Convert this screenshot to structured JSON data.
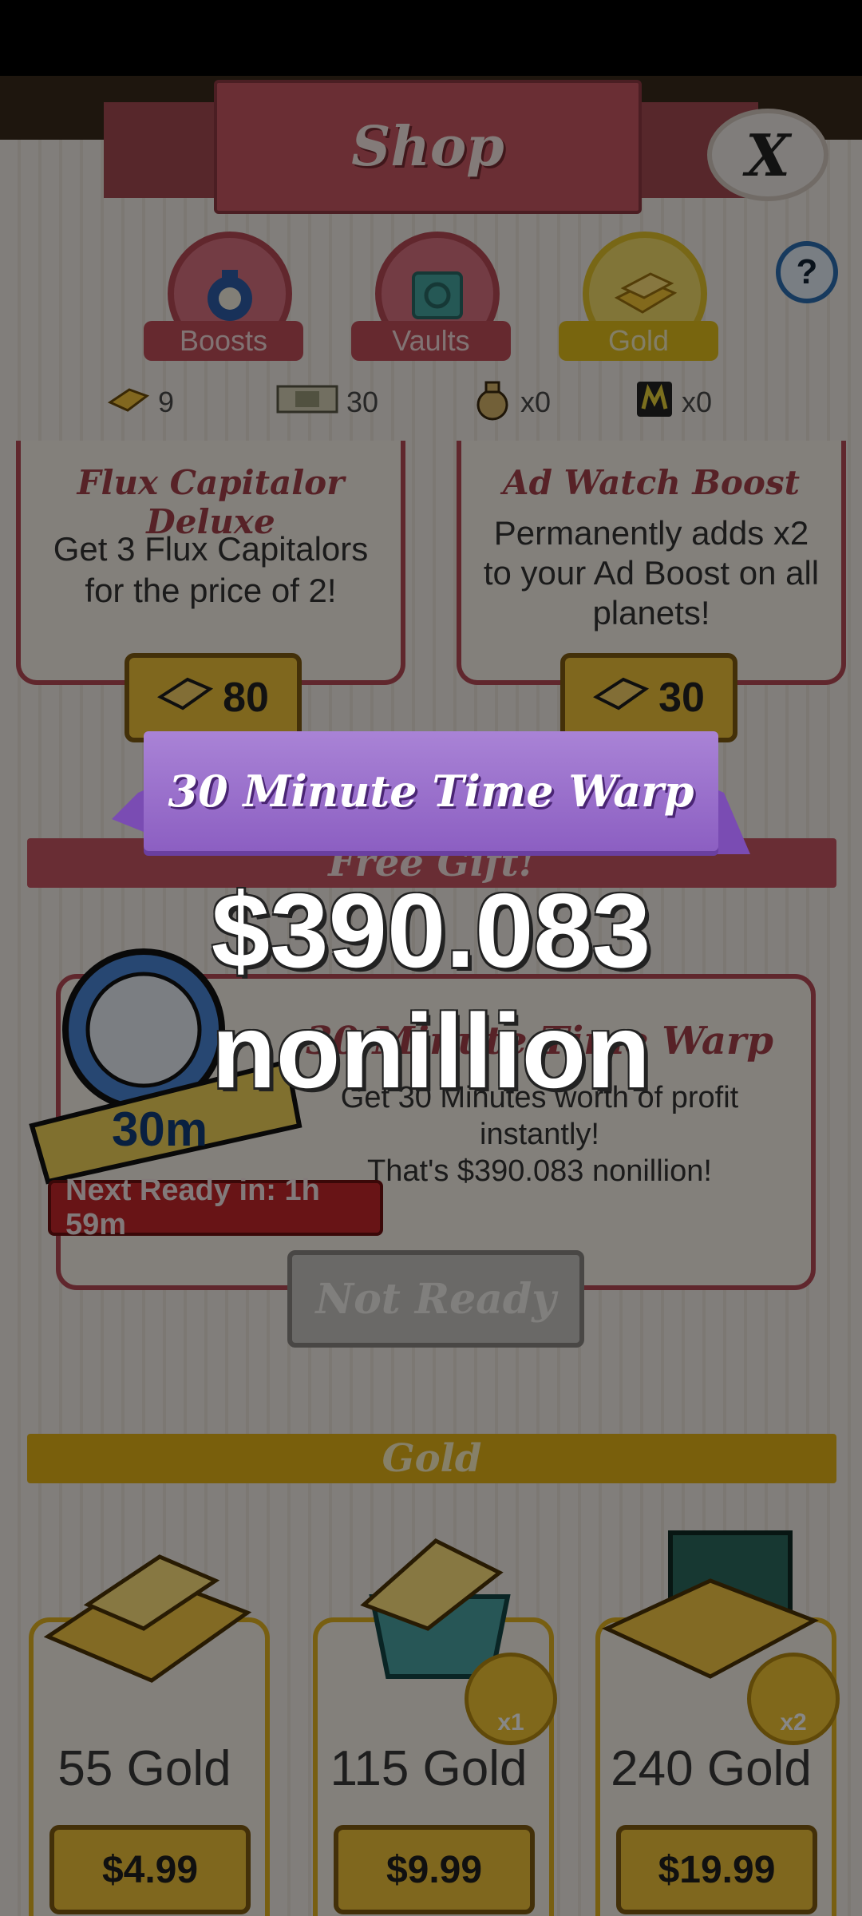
{
  "shop": {
    "title": "Shop",
    "close_label": "X",
    "help_label": "?",
    "tabs": [
      {
        "label": "Boosts",
        "icon": "boosts-bag-icon",
        "active": false
      },
      {
        "label": "Vaults",
        "icon": "vault-icon",
        "active": false
      },
      {
        "label": "Gold",
        "icon": "gold-bars-icon",
        "active": true
      }
    ],
    "currencies": [
      {
        "icon": "gold-icon",
        "value": "9"
      },
      {
        "icon": "megabucks-icon",
        "value": "30"
      },
      {
        "icon": "money-bag-icon",
        "value": "x0"
      },
      {
        "icon": "megaticket-icon",
        "value": "x0"
      }
    ]
  },
  "boost_cards": [
    {
      "title": "Flux Capitalor Deluxe",
      "desc_1": "Get 3 Flux Capitalors",
      "desc_2": "for the price of 2!",
      "desc_3": "",
      "price": "80"
    },
    {
      "title": "Ad Watch Boost",
      "desc_1": "Permanently adds x2",
      "desc_2": "to your Ad Boost on all",
      "desc_3": "planets!",
      "price": "30"
    }
  ],
  "free_gift": {
    "banner": "Free Gift!",
    "title": "30 Minute Time Warp",
    "desc_1": "Get 30 Minutes worth of profit",
    "desc_2": "instantly!",
    "desc_3": "That's $390.083 nonillion!",
    "icon_label": "30m",
    "next_ready": "Next Ready in: 1h 59m",
    "button": "Not Ready"
  },
  "gold_section": {
    "banner": "Gold",
    "items": [
      {
        "label": "55 Gold",
        "price": "$4.99",
        "badge": ""
      },
      {
        "label": "115 Gold",
        "price": "$9.99",
        "badge": "x1"
      },
      {
        "label": "240 Gold",
        "price": "$19.99",
        "badge": "x2"
      }
    ]
  },
  "popup": {
    "title": "30 Minute Time Warp",
    "amount": "$390.083 nonillion"
  },
  "colors": {
    "accent_red": "#c85863",
    "gold": "#f0c23a",
    "popup_purple": "#9a6ccc"
  }
}
